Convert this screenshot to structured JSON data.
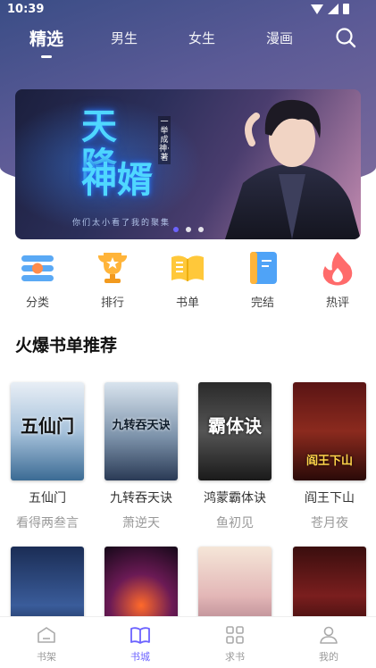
{
  "status": {
    "time": "10:39"
  },
  "top_tabs": [
    {
      "label": "精选",
      "active": true
    },
    {
      "label": "男生",
      "active": false
    },
    {
      "label": "女生",
      "active": false
    },
    {
      "label": "漫画",
      "active": false
    }
  ],
  "banner": {
    "title_line1": "天降",
    "title_line2": "神婿",
    "byline": "一举成神·著",
    "tagline": "你们太小看了我的聚集",
    "slide_index": 1,
    "slide_count": 3
  },
  "quick_links": [
    {
      "label": "分类",
      "icon": "category-icon"
    },
    {
      "label": "排行",
      "icon": "trophy-icon"
    },
    {
      "label": "书单",
      "icon": "book-list-icon"
    },
    {
      "label": "完结",
      "icon": "finished-book-icon"
    },
    {
      "label": "热评",
      "icon": "flame-icon"
    }
  ],
  "section": {
    "title": "火爆书单推荐"
  },
  "books_row1": [
    {
      "name": "五仙门",
      "author": "看得两叁言",
      "cover_text": "五仙门"
    },
    {
      "name": "九转吞天诀",
      "author": "萧逆天",
      "cover_text": "九转吞天诀"
    },
    {
      "name": "鸿蒙霸体诀",
      "author": "鱼初见",
      "cover_text": "霸体诀"
    },
    {
      "name": "阎王下山",
      "author": "苍月夜",
      "cover_text": "阎王下山"
    }
  ],
  "bottom_tabs": [
    {
      "label": "书架",
      "icon": "bookshelf-icon",
      "active": false
    },
    {
      "label": "书城",
      "icon": "book-open-icon",
      "active": true
    },
    {
      "label": "求书",
      "icon": "grid-icon",
      "active": false
    },
    {
      "label": "我的",
      "icon": "user-icon",
      "active": false
    }
  ],
  "colors": {
    "accent": "#6c63ff",
    "header_gradient_start": "#3a4d86",
    "header_gradient_end": "#7c6a9c"
  }
}
